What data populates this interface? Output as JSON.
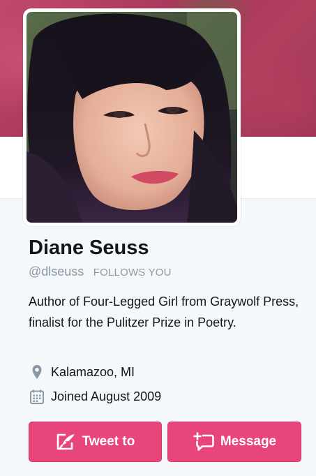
{
  "profile": {
    "name": "Diane Seuss",
    "handle": "@dlseuss",
    "follows_you": "FOLLOWS YOU",
    "bio": "Author of Four-Legged Girl from Graywolf Press, finalist for the Pulitzer Prize in Poetry.",
    "location": "Kalamazoo, MI",
    "joined": "Joined August 2009"
  },
  "actions": {
    "tweet_label": "Tweet to",
    "message_label": "Message"
  },
  "icons": {
    "location": "map-pin-icon",
    "joined": "calendar-icon",
    "tweet": "feather-icon",
    "message": "message-plus-icon"
  },
  "colors": {
    "accent": "#e8457a",
    "banner": "#b1405f",
    "muted_text": "#8a98a5",
    "text": "#14171a"
  }
}
